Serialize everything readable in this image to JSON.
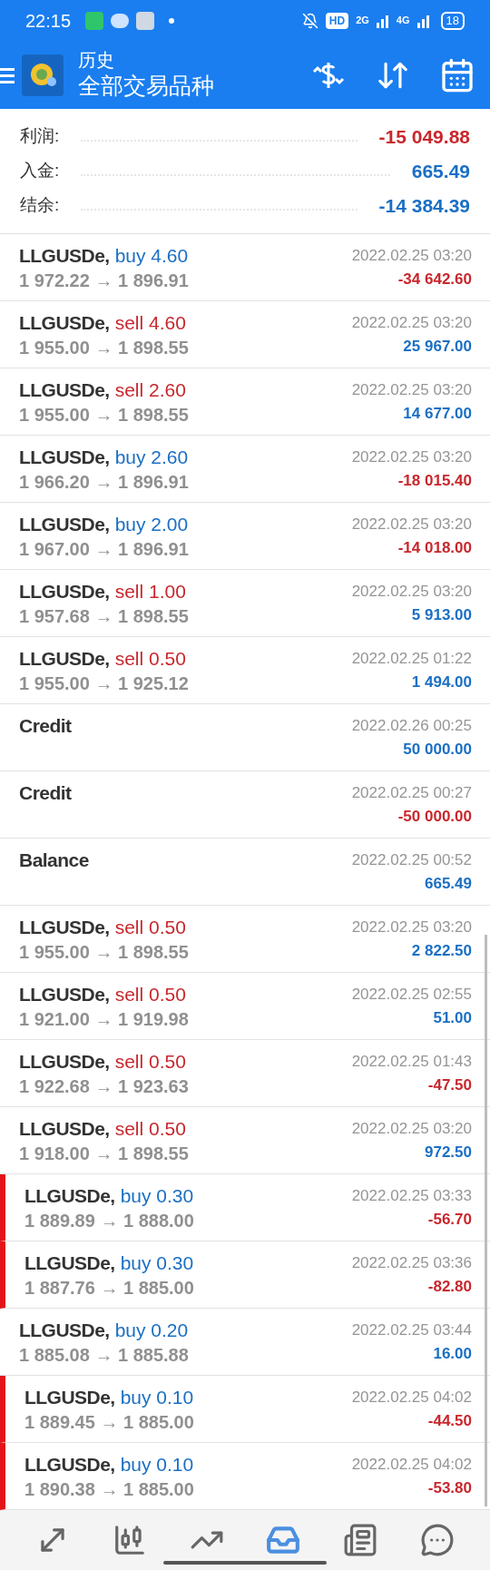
{
  "status_bar": {
    "time": "22:15",
    "hd": "HD",
    "net_1": "2G",
    "net_2": "4G",
    "battery": "18"
  },
  "app_bar": {
    "title": "历史",
    "subtitle": "全部交易品种"
  },
  "summary": [
    {
      "label": "利润:",
      "value": "-15 049.88",
      "loss": true
    },
    {
      "label": "入金:",
      "value": "665.49",
      "loss": false
    },
    {
      "label": "结余:",
      "value": "-14 384.39",
      "loss": false
    }
  ],
  "deals": [
    {
      "kind": "buy",
      "symbol": "LLGUSDe,",
      "deal": "buy 4.60",
      "prices": "1 972.22 → 1 896.91",
      "time": "2022.02.25 03:20",
      "profit": "-34 642.60",
      "loss": true,
      "marked": false
    },
    {
      "kind": "sell",
      "symbol": "LLGUSDe,",
      "deal": "sell 4.60",
      "prices": "1 955.00 → 1 898.55",
      "time": "2022.02.25 03:20",
      "profit": "25 967.00",
      "loss": false,
      "marked": false
    },
    {
      "kind": "sell",
      "symbol": "LLGUSDe,",
      "deal": "sell 2.60",
      "prices": "1 955.00 → 1 898.55",
      "time": "2022.02.25 03:20",
      "profit": "14 677.00",
      "loss": false,
      "marked": false
    },
    {
      "kind": "buy",
      "symbol": "LLGUSDe,",
      "deal": "buy 2.60",
      "prices": "1 966.20 → 1 896.91",
      "time": "2022.02.25 03:20",
      "profit": "-18 015.40",
      "loss": true,
      "marked": false
    },
    {
      "kind": "buy",
      "symbol": "LLGUSDe,",
      "deal": "buy 2.00",
      "prices": "1 967.00 → 1 896.91",
      "time": "2022.02.25 03:20",
      "profit": "-14 018.00",
      "loss": true,
      "marked": false
    },
    {
      "kind": "sell",
      "symbol": "LLGUSDe,",
      "deal": "sell 1.00",
      "prices": "1 957.68 → 1 898.55",
      "time": "2022.02.25 03:20",
      "profit": "5 913.00",
      "loss": false,
      "marked": false
    },
    {
      "kind": "sell",
      "symbol": "LLGUSDe,",
      "deal": "sell 0.50",
      "prices": "1 955.00 → 1 925.12",
      "time": "2022.02.25 01:22",
      "profit": "1 494.00",
      "loss": false,
      "marked": false
    },
    {
      "kind": "balance",
      "symbol": "Credit",
      "time": "2022.02.26 00:25",
      "profit": "50 000.00",
      "loss": false,
      "marked": false
    },
    {
      "kind": "balance",
      "symbol": "Credit",
      "time": "2022.02.25 00:27",
      "profit": "-50 000.00",
      "loss": true,
      "marked": false
    },
    {
      "kind": "balance",
      "symbol": "Balance",
      "time": "2022.02.25 00:52",
      "profit": "665.49",
      "loss": false,
      "marked": false
    },
    {
      "kind": "sell",
      "symbol": "LLGUSDe,",
      "deal": "sell 0.50",
      "prices": "1 955.00 → 1 898.55",
      "time": "2022.02.25 03:20",
      "profit": "2 822.50",
      "loss": false,
      "marked": false
    },
    {
      "kind": "sell",
      "symbol": "LLGUSDe,",
      "deal": "sell 0.50",
      "prices": "1 921.00 → 1 919.98",
      "time": "2022.02.25 02:55",
      "profit": "51.00",
      "loss": false,
      "marked": false
    },
    {
      "kind": "sell",
      "symbol": "LLGUSDe,",
      "deal": "sell 0.50",
      "prices": "1 922.68 → 1 923.63",
      "time": "2022.02.25 01:43",
      "profit": "-47.50",
      "loss": true,
      "marked": false
    },
    {
      "kind": "sell",
      "symbol": "LLGUSDe,",
      "deal": "sell 0.50",
      "prices": "1 918.00 → 1 898.55",
      "time": "2022.02.25 03:20",
      "profit": "972.50",
      "loss": false,
      "marked": false
    },
    {
      "kind": "buy",
      "symbol": "LLGUSDe,",
      "deal": "buy 0.30",
      "prices": "1 889.89 → 1 888.00",
      "time": "2022.02.25 03:33",
      "profit": "-56.70",
      "loss": true,
      "marked": true
    },
    {
      "kind": "buy",
      "symbol": "LLGUSDe,",
      "deal": "buy 0.30",
      "prices": "1 887.76 → 1 885.00",
      "time": "2022.02.25 03:36",
      "profit": "-82.80",
      "loss": true,
      "marked": true
    },
    {
      "kind": "buy",
      "symbol": "LLGUSDe,",
      "deal": "buy 0.20",
      "prices": "1 885.08 → 1 885.88",
      "time": "2022.02.25 03:44",
      "profit": "16.00",
      "loss": false,
      "marked": false
    },
    {
      "kind": "buy",
      "symbol": "LLGUSDe,",
      "deal": "buy 0.10",
      "prices": "1 889.45 → 1 885.00",
      "time": "2022.02.25 04:02",
      "profit": "-44.50",
      "loss": true,
      "marked": true
    },
    {
      "kind": "buy",
      "symbol": "LLGUSDe,",
      "deal": "buy 0.10",
      "prices": "1 890.38 → 1 885.00",
      "time": "2022.02.25 04:02",
      "profit": "-53.80",
      "loss": true,
      "marked": true
    }
  ],
  "bottom_nav": [
    {
      "kind": "quotes",
      "selected": false
    },
    {
      "kind": "chart",
      "selected": false
    },
    {
      "kind": "trade",
      "selected": false
    },
    {
      "kind": "history",
      "selected": true
    },
    {
      "kind": "news",
      "selected": false
    },
    {
      "kind": "chat",
      "selected": false
    }
  ]
}
